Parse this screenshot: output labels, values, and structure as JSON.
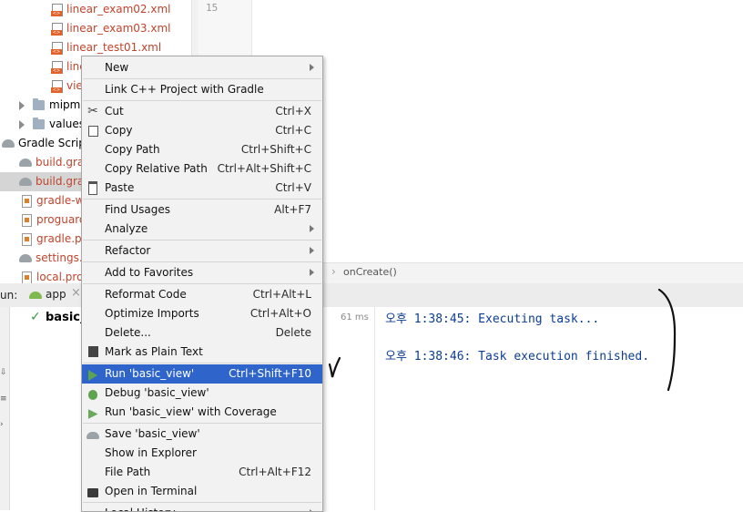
{
  "tree": {
    "items": [
      {
        "label": "linear_exam02.xml"
      },
      {
        "label": "linear_exam03.xml"
      },
      {
        "label": "linear_test01.xml"
      },
      {
        "label": "line"
      },
      {
        "label": "vie"
      },
      {
        "label": "mipm"
      },
      {
        "label": "values"
      },
      {
        "label": "Gradle Script"
      },
      {
        "label": "build.grad"
      },
      {
        "label": "build.grad"
      },
      {
        "label": "gradle-wr"
      },
      {
        "label": "proguard"
      },
      {
        "label": "gradle.pro"
      },
      {
        "label": "settings.g"
      },
      {
        "label": "local.prop"
      }
    ]
  },
  "editor": {
    "line_number": "15",
    "breadcrumb_sep": "›",
    "breadcrumb": "onCreate()"
  },
  "run_panel": {
    "label": "un:",
    "tab_label": "app",
    "close_glyph": "×",
    "build_item": "basic_v",
    "build_time": "61 ms",
    "console": [
      "오후 1:38:45: Executing task...",
      "오후 1:38:46: Task execution finished."
    ]
  },
  "context_menu": {
    "items": [
      {
        "label": "New",
        "shortcut": "",
        "submenu": true,
        "icon": ""
      },
      {
        "label": "Link C++ Project with Gradle",
        "shortcut": "",
        "submenu": false,
        "icon": ""
      },
      {
        "label": "Cut",
        "shortcut": "Ctrl+X",
        "submenu": false,
        "icon": "scissors-icon"
      },
      {
        "label": "Copy",
        "shortcut": "Ctrl+C",
        "submenu": false,
        "icon": "copy-icon"
      },
      {
        "label": "Copy Path",
        "shortcut": "Ctrl+Shift+C",
        "submenu": false,
        "icon": ""
      },
      {
        "label": "Copy Relative Path",
        "shortcut": "Ctrl+Alt+Shift+C",
        "submenu": false,
        "icon": ""
      },
      {
        "label": "Paste",
        "shortcut": "Ctrl+V",
        "submenu": false,
        "icon": "paste-icon"
      },
      {
        "label": "Find Usages",
        "shortcut": "Alt+F7",
        "submenu": false,
        "icon": ""
      },
      {
        "label": "Analyze",
        "shortcut": "",
        "submenu": true,
        "icon": ""
      },
      {
        "label": "Refactor",
        "shortcut": "",
        "submenu": true,
        "icon": ""
      },
      {
        "label": "Add to Favorites",
        "shortcut": "",
        "submenu": true,
        "icon": ""
      },
      {
        "label": "Reformat Code",
        "shortcut": "Ctrl+Alt+L",
        "submenu": false,
        "icon": ""
      },
      {
        "label": "Optimize Imports",
        "shortcut": "Ctrl+Alt+O",
        "submenu": false,
        "icon": ""
      },
      {
        "label": "Delete...",
        "shortcut": "Delete",
        "submenu": false,
        "icon": ""
      },
      {
        "label": "Mark as Plain Text",
        "shortcut": "",
        "submenu": false,
        "icon": "plain-text-icon"
      },
      {
        "label": "Run 'basic_view'",
        "shortcut": "Ctrl+Shift+F10",
        "submenu": false,
        "icon": "run-icon",
        "selected": true
      },
      {
        "label": "Debug 'basic_view'",
        "shortcut": "",
        "submenu": false,
        "icon": "debug-icon"
      },
      {
        "label": "Run 'basic_view' with Coverage",
        "shortcut": "",
        "submenu": false,
        "icon": "coverage-icon"
      },
      {
        "label": "Save 'basic_view'",
        "shortcut": "",
        "submenu": false,
        "icon": "gradle-icon"
      },
      {
        "label": "Show in Explorer",
        "shortcut": "",
        "submenu": false,
        "icon": ""
      },
      {
        "label": "File Path",
        "shortcut": "Ctrl+Alt+F12",
        "submenu": false,
        "icon": ""
      },
      {
        "label": "Open in Terminal",
        "shortcut": "",
        "submenu": false,
        "icon": "terminal-icon"
      },
      {
        "label": "Local History",
        "shortcut": "",
        "submenu": true,
        "icon": ""
      }
    ]
  },
  "colors": {
    "selection": "#2f65ca",
    "console_text": "#0b3d91",
    "xml_file_text": "#c0442c"
  }
}
